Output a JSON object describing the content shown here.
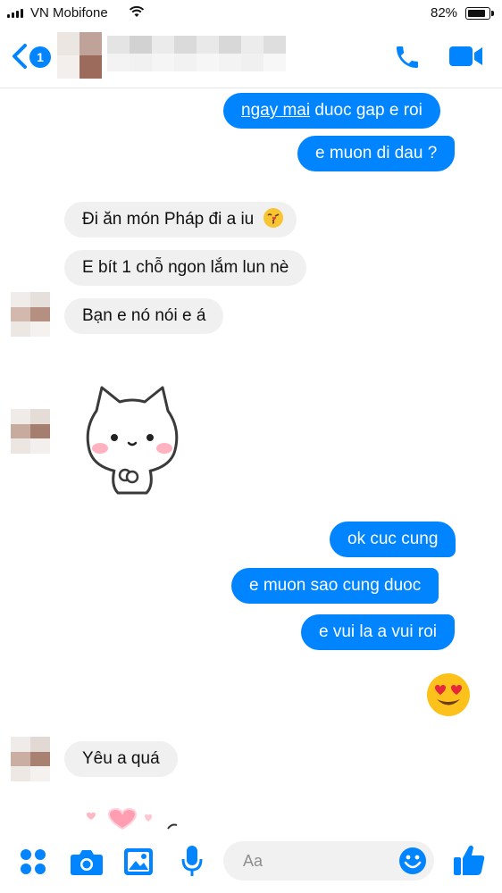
{
  "status_bar": {
    "carrier": "VN Mobifone",
    "battery": "82%"
  },
  "header": {
    "unread_count": "1"
  },
  "messages": {
    "m1_link": "ngay mai",
    "m1_rest": " duoc gap e roi",
    "m2": "e muon di dau ?",
    "m3": "Đi ăn món Pháp đi a iu",
    "m4": "E bít 1 chỗ ngon lắm lun nè",
    "m5": "Bạn e nó nói e á",
    "m6": "ok cuc cung",
    "m7": "e muon sao cung duoc",
    "m8": "e vui la a vui roi",
    "m9": "Yêu a quá"
  },
  "composer": {
    "placeholder": "Aa"
  },
  "colors": {
    "accent": "#0084ff",
    "received_bubble": "#f1f0f0"
  },
  "icons": [
    "back-chevron-icon",
    "phone-icon",
    "video-camera-icon",
    "grid-dots-icon",
    "camera-icon",
    "image-icon",
    "microphone-icon",
    "smile-icon",
    "thumbs-up-icon",
    "kiss-emoji-icon",
    "heart-eyes-emoji-icon"
  ]
}
